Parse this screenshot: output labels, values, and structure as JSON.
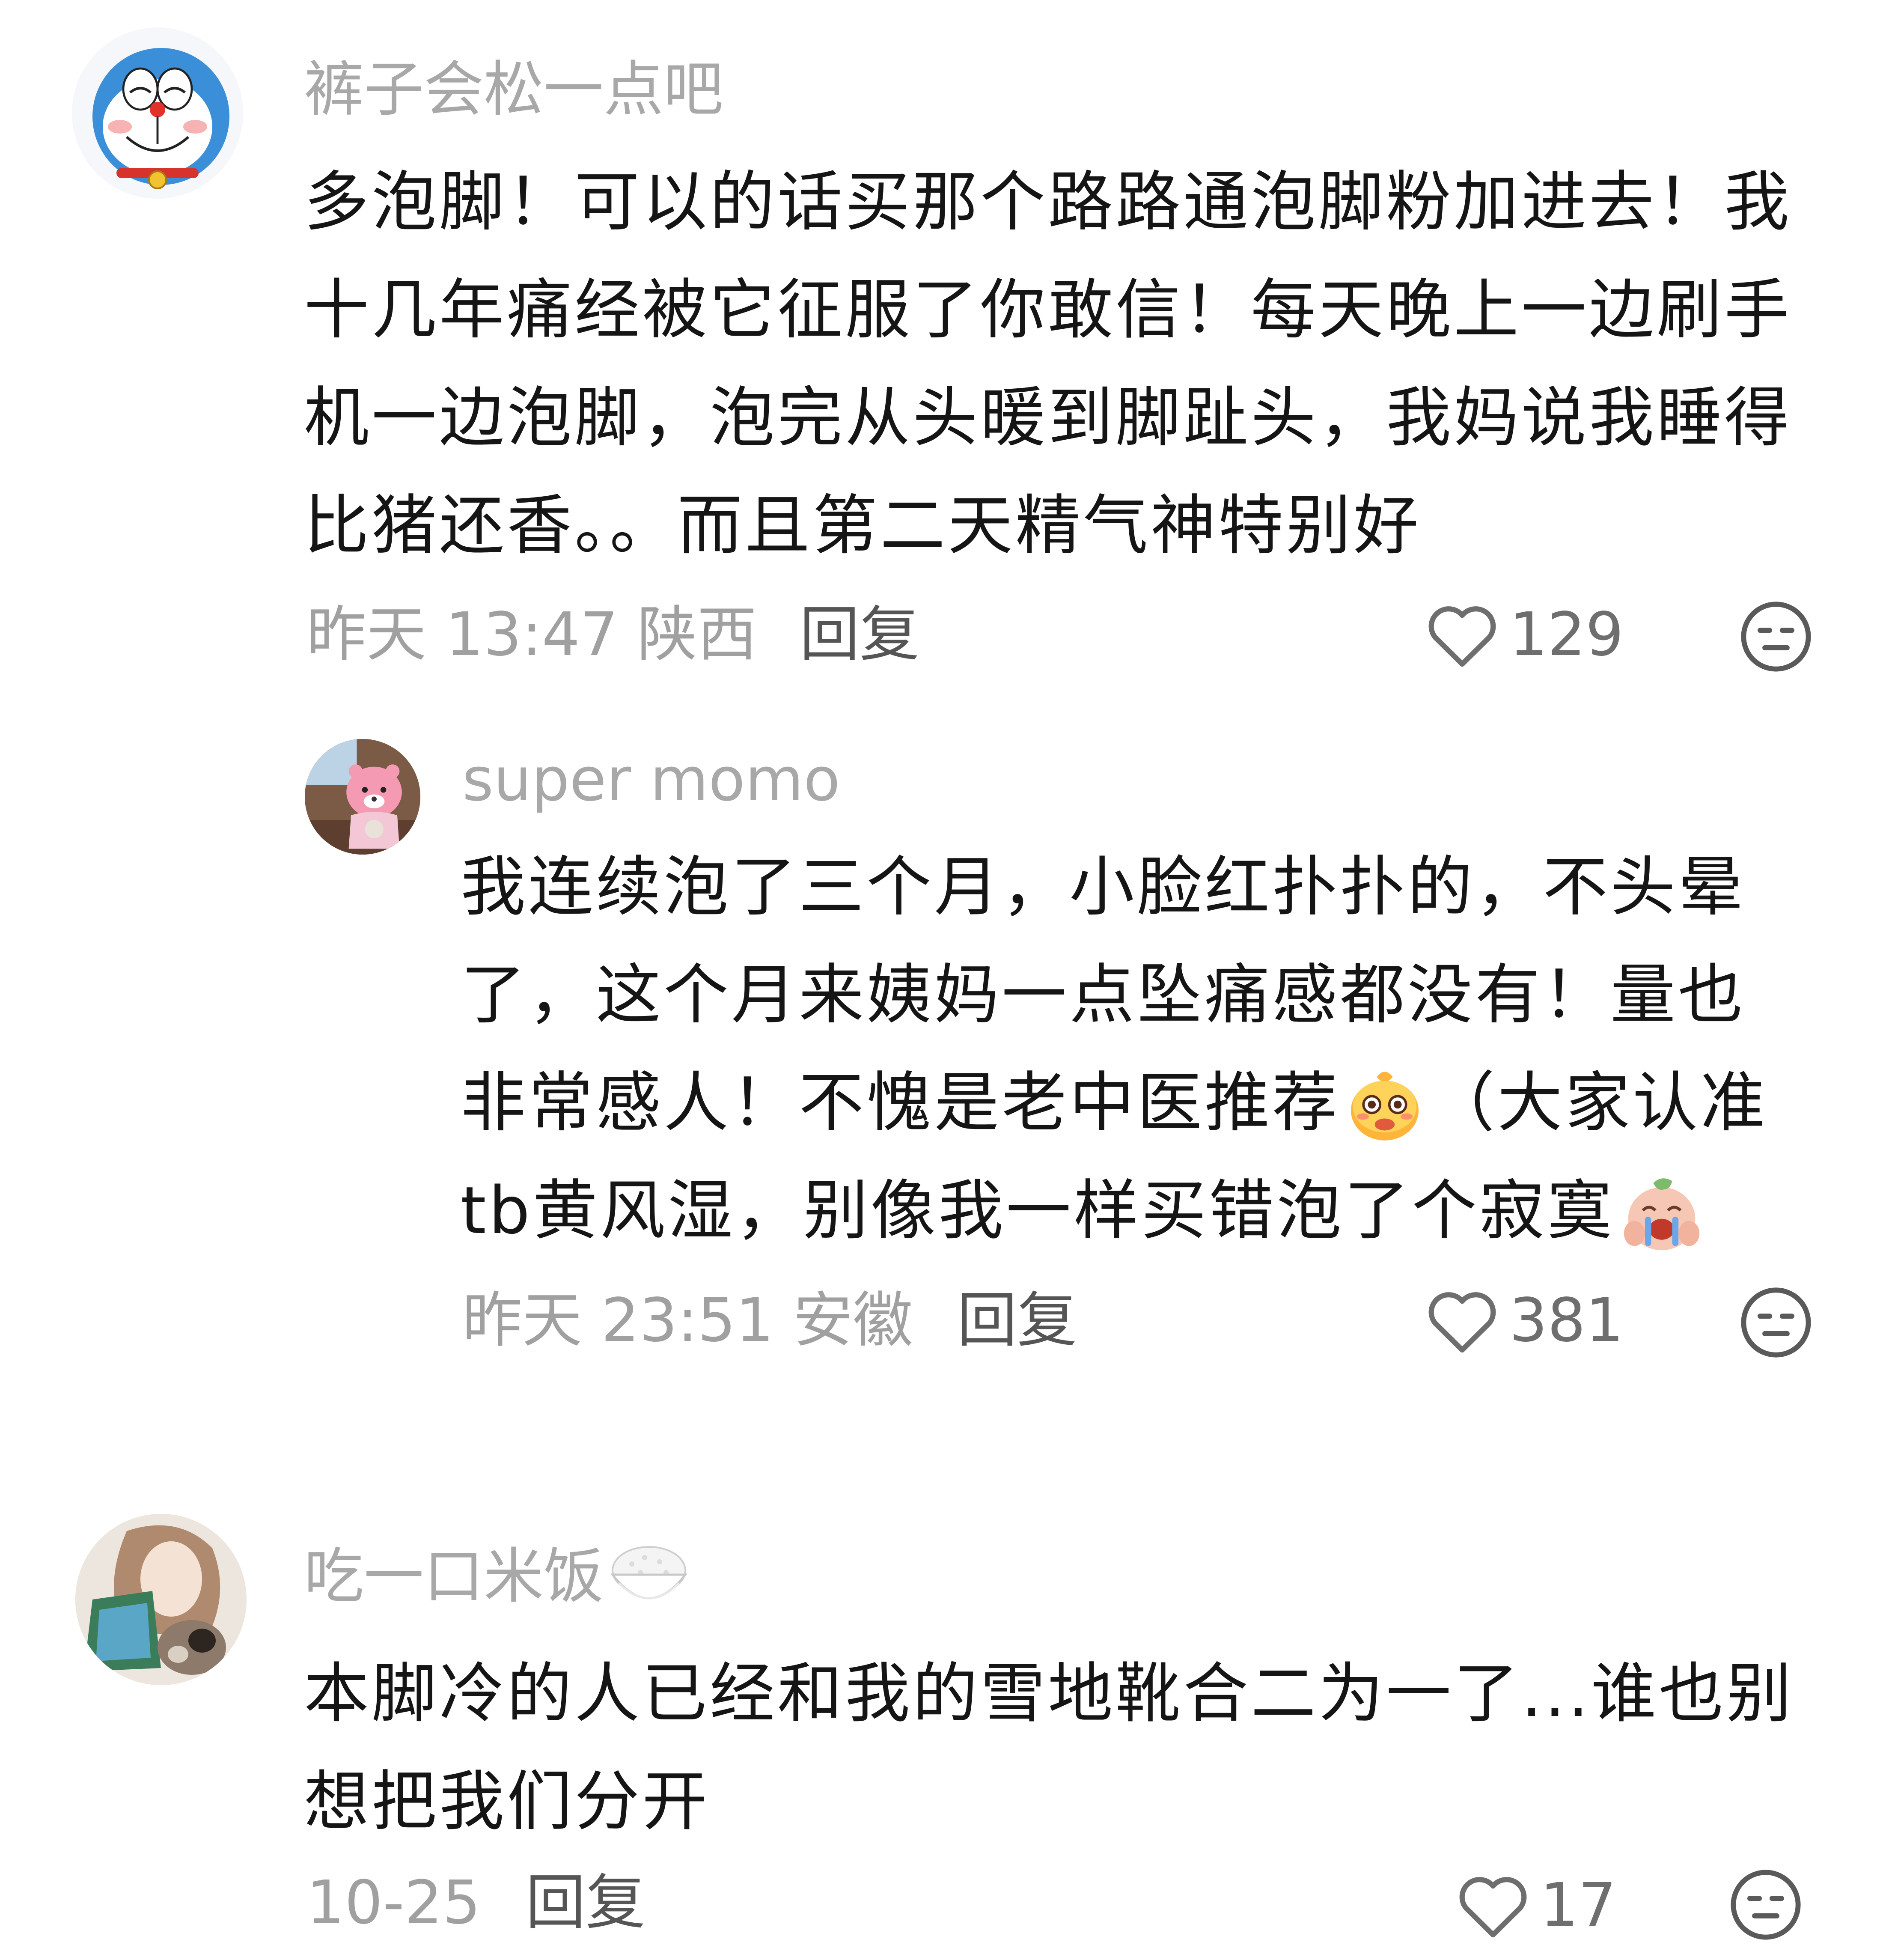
{
  "comments": [
    {
      "username": "裤子会松一点吧",
      "text": "多泡脚！可以的话买那个路路通泡脚粉加进去！我\n十几年痛经被它征服了你敢信！每天晚上一边刷手\n机一边泡脚，泡完从头暖到脚趾头，我妈说我睡得\n比猪还香。。而且第二天精气神特别好",
      "time": "昨天 13:47 陕西",
      "reply_label": "回复",
      "likes": "129",
      "avatar_icon": "doraemon-avatar",
      "replies": [
        {
          "username": "super momo",
          "text_part1": "我连续泡了三个月，小脸红扑扑的，不头晕\n了，这个月来姨妈一点坠痛感都没有！量也\n非常感人！不愧是老中医推荐",
          "text_part2": "（大家认准\ntb黄风湿，别像我一样买错泡了个寂寞",
          "emoji_1": "proud-face-emoji",
          "emoji_2": "crying-face-emoji",
          "time": "昨天 23:51 安徽",
          "reply_label": "回复",
          "likes": "381",
          "avatar_icon": "pink-beaver-avatar"
        }
      ]
    },
    {
      "username": "吃一口米饭",
      "username_emoji": "rice-bowl-emoji",
      "text": "本脚冷的人已经和我的雪地靴合二为一了...谁也别\n想把我们分开",
      "time": "10-25",
      "reply_label": "回复",
      "likes": "17",
      "avatar_icon": "girl-with-cat-avatar"
    }
  ],
  "colors": {
    "username": "#a8a8a8",
    "body": "#151515",
    "meta": "#a0a0a0",
    "reply": "#555555",
    "icon": "#6e6e6e"
  }
}
